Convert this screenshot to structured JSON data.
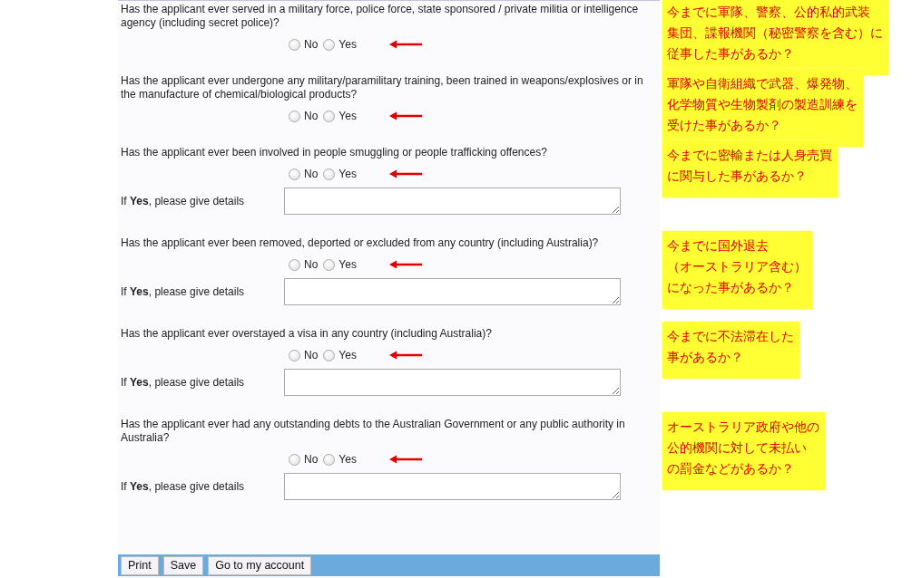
{
  "questions": [
    {
      "text": "Has the applicant ever served in a military force, police force, state sponsored / private militia or intelligence agency (including secret police)?",
      "options": [
        {
          "label": "No",
          "selected": false
        },
        {
          "label": "Yes",
          "selected": false
        }
      ],
      "note": [
        "今までに軍隊、警察、公的私的武装",
        "集団、諜報機関（秘密警察を含む）に",
        "従事した事があるか？"
      ]
    },
    {
      "text": "Has the applicant ever undergone any military/paramilitary training, been trained in weapons/explosives or in the manufacture of chemical/biological products?",
      "options": [
        {
          "label": "No",
          "selected": false
        },
        {
          "label": "Yes",
          "selected": false
        }
      ],
      "note": [
        "軍隊や自衛組織で武器、爆発物、",
        "化学物質や生物製剤の製造訓練を",
        "受けた事があるか？"
      ]
    },
    {
      "text": "Has the applicant ever been involved in people smuggling or people trafficking offences?",
      "options": [
        {
          "label": "No",
          "selected": false
        },
        {
          "label": "Yes",
          "selected": false
        }
      ],
      "details_label": "If **Yes**, please give details",
      "note": [
        "今までに密輸または人身売買",
        "に関与した事があるか？"
      ]
    },
    {
      "text": "Has the applicant ever been removed, deported or excluded from any country (including Australia)?",
      "options": [
        {
          "label": "No",
          "selected": false
        },
        {
          "label": "Yes",
          "selected": false
        }
      ],
      "details_label": "If **Yes**, please give details",
      "note": [
        "今までに国外退去",
        "（オーストラリア含む）",
        "になった事があるか？"
      ]
    },
    {
      "text": "Has the applicant ever overstayed a visa in any country (including Australia)?",
      "options": [
        {
          "label": "No",
          "selected": false
        },
        {
          "label": "Yes",
          "selected": false
        }
      ],
      "details_label": "If **Yes**, please give details",
      "note": [
        "今までに不法滞在した",
        "事があるか？"
      ]
    },
    {
      "text": "Has the applicant ever had any outstanding debts to the Australian Government or any public authority in Australia?",
      "options": [
        {
          "label": "No",
          "selected": false
        },
        {
          "label": "Yes",
          "selected": false
        }
      ],
      "details_label": "If **Yes**, please give details",
      "note": [
        "オーストラリア政府や他の",
        "公的機関に対して未払い",
        "の罰金などがあるか？"
      ]
    }
  ],
  "buttons": [
    "Print",
    "Save",
    "Go to my account"
  ]
}
